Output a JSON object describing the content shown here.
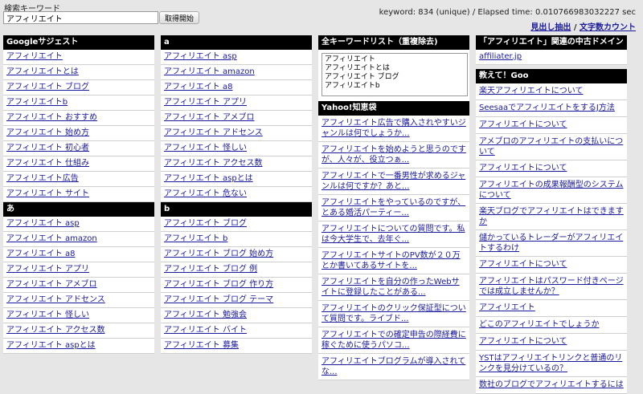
{
  "search": {
    "label": "検索キーワード",
    "value": "アフィリエイト",
    "button": "取得開始"
  },
  "stats": {
    "text": "keyword: 834 (unique) / Elapsed time: 0.010766983032227 sec",
    "link1": "見出し抽出",
    "separator": " / ",
    "link2": "文字数カウント"
  },
  "col1": {
    "sections": [
      {
        "title": "Googleサジェスト",
        "items": [
          "アフィリエイト",
          "アフィリエイトとは",
          "アフィリエイト ブログ",
          "アフィリエイトb",
          "アフィリエイト おすすめ",
          "アフィリエイト 始め方",
          "アフィリエイト 初心者",
          "アフィリエイト 仕組み",
          "アフィリエイト広告",
          "アフィリエイト サイト"
        ]
      },
      {
        "title": "あ",
        "items": [
          "アフィリエイト asp",
          "アフィリエイト amazon",
          "アフィリエイト a8",
          "アフィリエイト アプリ",
          "アフィリエイト アメブロ",
          "アフィリエイト アドセンス",
          "アフィリエイト 怪しい",
          "アフィリエイト アクセス数",
          "アフィリエイト aspとは"
        ]
      }
    ]
  },
  "col2": {
    "sections": [
      {
        "title": "a",
        "items": [
          "アフィリエイト asp",
          "アフィリエイト amazon",
          "アフィリエイト a8",
          "アフィリエイト アプリ",
          "アフィリエイト アメブロ",
          "アフィリエイト アドセンス",
          "アフィリエイト 怪しい",
          "アフィリエイト アクセス数",
          "アフィリエイト aspとは",
          "アフィリエイト 危ない"
        ]
      },
      {
        "title": "b",
        "items": [
          "アフィリエイト ブログ",
          "アフィリエイト b",
          "アフィリエイト ブログ 始め方",
          "アフィリエイト ブログ 例",
          "アフィリエイト ブログ 作り方",
          "アフィリエイト ブログ テーマ",
          "アフィリエイト 勉強会",
          "アフィリエイト バイト",
          "アフィリエイト 募集"
        ]
      }
    ]
  },
  "col3": {
    "kw_title": "全キーワードリスト（重複除去)",
    "kw_list": "アフィリエイト\nアフィリエイトとは\nアフィリエイト ブログ\nアフィリエイトb",
    "yahoo_title": "Yahoo!知恵袋",
    "yahoo_items": [
      "アフィリエイト広告で購入されやすいジャンルは何でしょうか...",
      "アフィリエイトを始めようと思うのですが、人々が、役立つぁ...",
      "アフィリエイトで一番男性が求めるジャンルは何ですか？あと...",
      "アフィリエイトをやっているのですが、とある婚活パーティー...",
      "アフィリエイトについての質問です。私は今大学生で、去年ぐ...",
      "アフィリエイトサイトのPV数が２０万とか書いてあるサイトを...",
      "アフィリエイトを自分の作ったWebサイトに登録したことがある...",
      "アフィリエイトのクリック保証型について質問です。ライブド...",
      "アフィリエイトでの確定申告の際経費に稼ぐために使うパソコ...",
      "アフィリエイトブログラムが導入されてな..."
    ]
  },
  "col4": {
    "domain_title": "「アフィリエイト」関連の中古ドメイン",
    "domain_items": [
      "affiliater.jp"
    ],
    "goo_title": "教えて！Goo",
    "goo_items": [
      "楽天アフィリエイトについて",
      "SeesaaでアフィリエイトをするJ方法",
      "アフィリエイトについて",
      "アメブロのアフィリエイトの支払いについて",
      "アフィリエイトについて",
      "アフィリエイトの成果報酬型のシステムについて",
      "楽天ブログでアフィリエイトはできますか",
      "儲かっているトレーダーがアフィリエイトするわけ",
      "アフィリエイトについて",
      "アフィリエイトはパスワード付きページでは成立しませんか？",
      "アフィリエイト",
      "どこのアフィリエイトでしょうか",
      "アフィリエイトについて",
      "YSTはアフィリエイトリンクと普通のリンクを見分けているの？",
      "数社のブログでアフィリエイトするには"
    ]
  }
}
